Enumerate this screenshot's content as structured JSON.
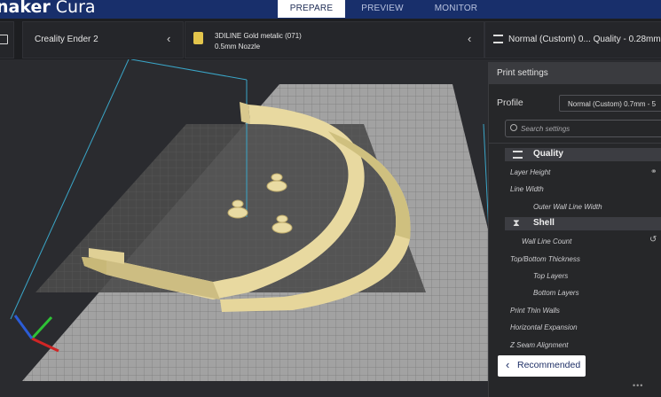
{
  "app": {
    "brand_bold": "naker",
    "brand_light": " Cura"
  },
  "tabs": [
    {
      "label": "PREPARE",
      "active": true
    },
    {
      "label": "PREVIEW",
      "active": false
    },
    {
      "label": "MONITOR",
      "active": false
    }
  ],
  "printer": {
    "name": "Creality Ender 2"
  },
  "material": {
    "name": "3DILINE Gold metalic (071)",
    "nozzle": "0.5mm Nozzle"
  },
  "profile_summary": {
    "label": "Normal (Custom) 0... Quality - 0.28mm"
  },
  "print_settings": {
    "title": "Print settings",
    "profile_label": "Profile",
    "profile_value": "Normal (Custom) 0.7mm - 5",
    "search_placeholder": "Search settings",
    "categories": [
      {
        "label": "Quality",
        "icon": "quality-icon"
      },
      {
        "label": "Shell",
        "icon": "shell-icon"
      }
    ],
    "settings": [
      "Layer Height",
      "Line Width",
      "Outer Wall Line Width",
      "Wall Line Count",
      "Top/Bottom Thickness",
      "Top Layers",
      "Bottom Layers",
      "Print Thin Walls",
      "Horizontal Expansion",
      "Z Seam Alignment"
    ],
    "recommended_label": "Recommended"
  },
  "colors": {
    "accent": "#182f6b",
    "model": "#e8d9a0",
    "build_plate": "#8f8f8f"
  }
}
